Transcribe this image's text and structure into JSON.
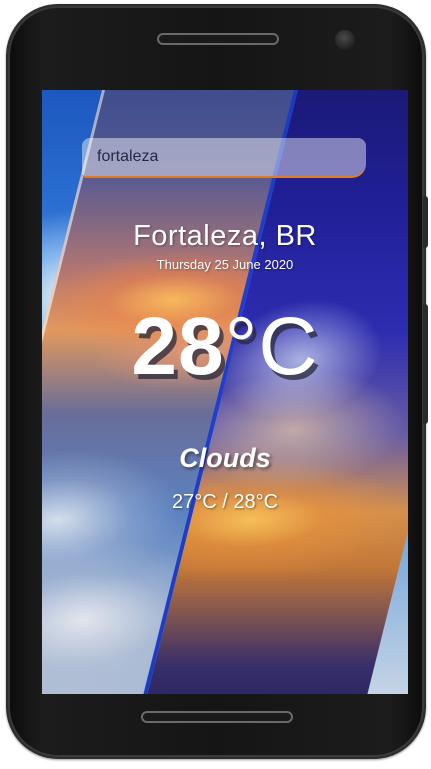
{
  "search": {
    "value": "fortaleza",
    "accent_color": "#e07b22"
  },
  "weather": {
    "location": "Fortaleza, BR",
    "date": "Thursday 25 June 2020",
    "temperature": "28",
    "temperature_unit": "°C",
    "condition": "Clouds",
    "range": "27°C / 28°C"
  }
}
